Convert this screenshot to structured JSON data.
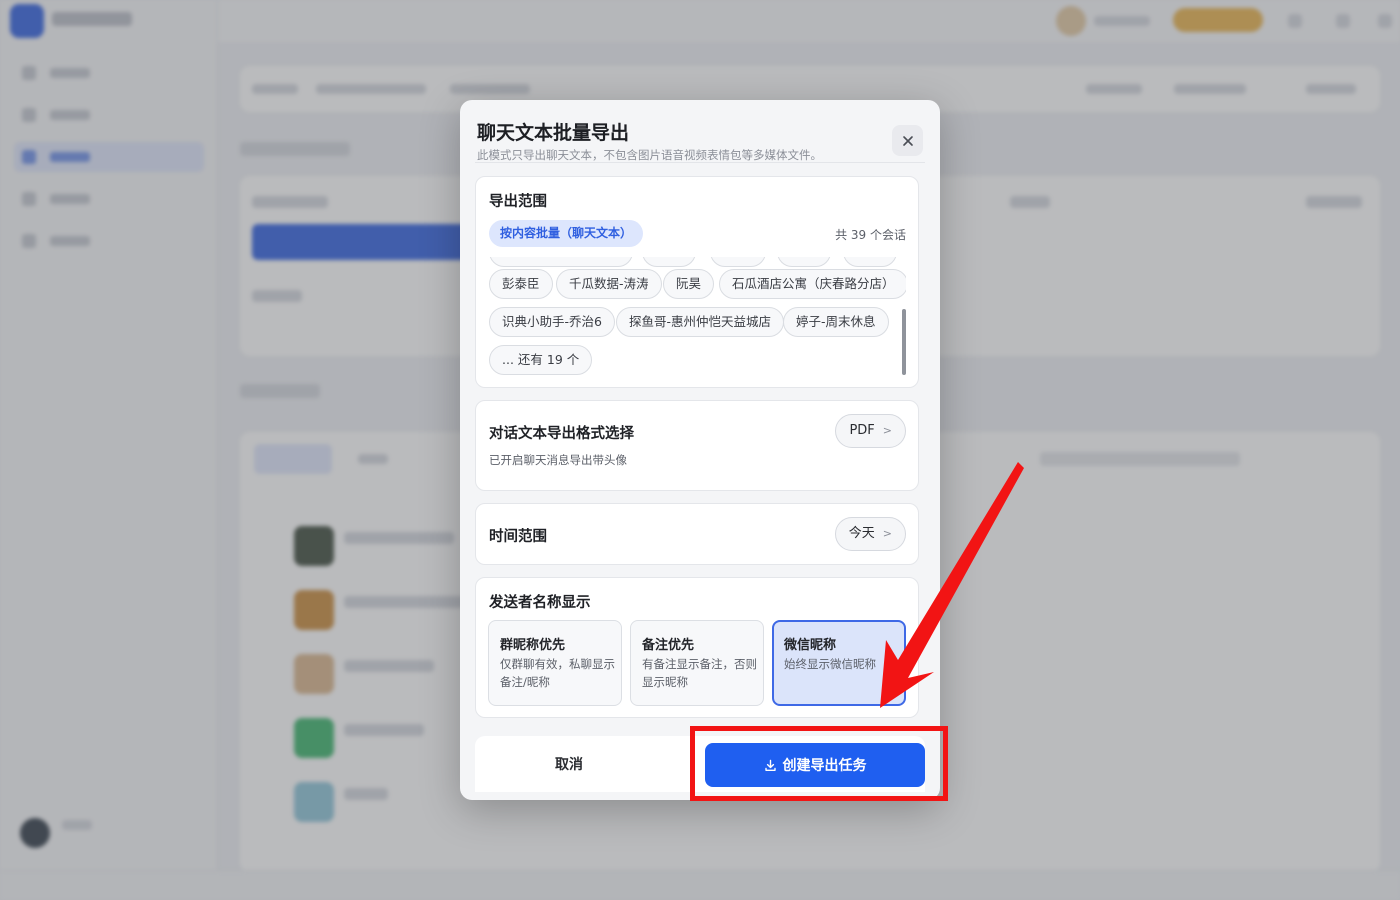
{
  "modal": {
    "title": "聊天文本批量导出",
    "subtitle": "此模式只导出聊天文本，不包含图片语音视频表情包等多媒体文件。",
    "close_icon": "close-icon"
  },
  "scope": {
    "title": "导出范围",
    "tab_label": "按内容批量（聊天文本）",
    "count_label": "共 39 个会话",
    "chips": [
      "彭泰臣",
      "千瓜数据-涛涛",
      "阮昊",
      "石瓜酒店公寓（庆春路分店）",
      "识典小助手-乔治6",
      "探鱼哥-惠州仲恺天益城店",
      "婷子-周末休息",
      "... 还有 19 个"
    ]
  },
  "format": {
    "title": "对话文本导出格式选择",
    "description": "已开启聊天消息导出带头像",
    "value": "PDF",
    "chevron": ">"
  },
  "time": {
    "title": "时间范围",
    "value": "今天",
    "chevron": ">"
  },
  "sender": {
    "title": "发送者名称显示",
    "options": [
      {
        "title": "群昵称优先",
        "desc": "仅群聊有效，私聊显示备注/昵称",
        "selected": false
      },
      {
        "title": "备注优先",
        "desc": "有备注显示备注，否则显示昵称",
        "selected": false
      },
      {
        "title": "微信昵称",
        "desc": "始终显示微信昵称",
        "selected": true
      }
    ]
  },
  "footer": {
    "cancel_label": "取消",
    "create_label": "创建导出任务",
    "create_icon": "download-icon"
  },
  "colors": {
    "accent": "#1f5ff0",
    "selected_bg": "#dbe4fa",
    "annotation": "#f21414"
  }
}
